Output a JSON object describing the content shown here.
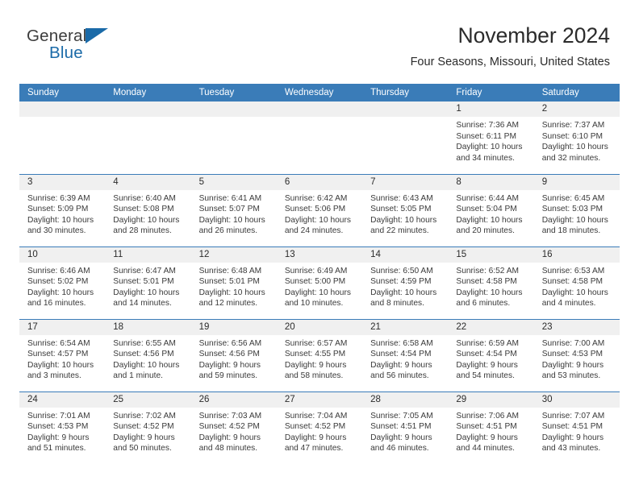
{
  "brand": {
    "word1": "General",
    "word2": "Blue",
    "accent_color": "#1a6aa8",
    "triangle_icon": "brand-triangle-icon"
  },
  "header": {
    "title": "November 2024",
    "subtitle": "Four Seasons, Missouri, United States"
  },
  "calendar": {
    "header_bg": "#3a7cb8",
    "header_text_color": "#ffffff",
    "day_band_bg": "#f0f0f0",
    "weekday_labels": [
      "Sunday",
      "Monday",
      "Tuesday",
      "Wednesday",
      "Thursday",
      "Friday",
      "Saturday"
    ],
    "weeks": [
      [
        {
          "day": "",
          "lines": []
        },
        {
          "day": "",
          "lines": []
        },
        {
          "day": "",
          "lines": []
        },
        {
          "day": "",
          "lines": []
        },
        {
          "day": "",
          "lines": []
        },
        {
          "day": "1",
          "lines": [
            "Sunrise: 7:36 AM",
            "Sunset: 6:11 PM",
            "Daylight: 10 hours",
            "and 34 minutes."
          ]
        },
        {
          "day": "2",
          "lines": [
            "Sunrise: 7:37 AM",
            "Sunset: 6:10 PM",
            "Daylight: 10 hours",
            "and 32 minutes."
          ]
        }
      ],
      [
        {
          "day": "3",
          "lines": [
            "Sunrise: 6:39 AM",
            "Sunset: 5:09 PM",
            "Daylight: 10 hours",
            "and 30 minutes."
          ]
        },
        {
          "day": "4",
          "lines": [
            "Sunrise: 6:40 AM",
            "Sunset: 5:08 PM",
            "Daylight: 10 hours",
            "and 28 minutes."
          ]
        },
        {
          "day": "5",
          "lines": [
            "Sunrise: 6:41 AM",
            "Sunset: 5:07 PM",
            "Daylight: 10 hours",
            "and 26 minutes."
          ]
        },
        {
          "day": "6",
          "lines": [
            "Sunrise: 6:42 AM",
            "Sunset: 5:06 PM",
            "Daylight: 10 hours",
            "and 24 minutes."
          ]
        },
        {
          "day": "7",
          "lines": [
            "Sunrise: 6:43 AM",
            "Sunset: 5:05 PM",
            "Daylight: 10 hours",
            "and 22 minutes."
          ]
        },
        {
          "day": "8",
          "lines": [
            "Sunrise: 6:44 AM",
            "Sunset: 5:04 PM",
            "Daylight: 10 hours",
            "and 20 minutes."
          ]
        },
        {
          "day": "9",
          "lines": [
            "Sunrise: 6:45 AM",
            "Sunset: 5:03 PM",
            "Daylight: 10 hours",
            "and 18 minutes."
          ]
        }
      ],
      [
        {
          "day": "10",
          "lines": [
            "Sunrise: 6:46 AM",
            "Sunset: 5:02 PM",
            "Daylight: 10 hours",
            "and 16 minutes."
          ]
        },
        {
          "day": "11",
          "lines": [
            "Sunrise: 6:47 AM",
            "Sunset: 5:01 PM",
            "Daylight: 10 hours",
            "and 14 minutes."
          ]
        },
        {
          "day": "12",
          "lines": [
            "Sunrise: 6:48 AM",
            "Sunset: 5:01 PM",
            "Daylight: 10 hours",
            "and 12 minutes."
          ]
        },
        {
          "day": "13",
          "lines": [
            "Sunrise: 6:49 AM",
            "Sunset: 5:00 PM",
            "Daylight: 10 hours",
            "and 10 minutes."
          ]
        },
        {
          "day": "14",
          "lines": [
            "Sunrise: 6:50 AM",
            "Sunset: 4:59 PM",
            "Daylight: 10 hours",
            "and 8 minutes."
          ]
        },
        {
          "day": "15",
          "lines": [
            "Sunrise: 6:52 AM",
            "Sunset: 4:58 PM",
            "Daylight: 10 hours",
            "and 6 minutes."
          ]
        },
        {
          "day": "16",
          "lines": [
            "Sunrise: 6:53 AM",
            "Sunset: 4:58 PM",
            "Daylight: 10 hours",
            "and 4 minutes."
          ]
        }
      ],
      [
        {
          "day": "17",
          "lines": [
            "Sunrise: 6:54 AM",
            "Sunset: 4:57 PM",
            "Daylight: 10 hours",
            "and 3 minutes."
          ]
        },
        {
          "day": "18",
          "lines": [
            "Sunrise: 6:55 AM",
            "Sunset: 4:56 PM",
            "Daylight: 10 hours",
            "and 1 minute."
          ]
        },
        {
          "day": "19",
          "lines": [
            "Sunrise: 6:56 AM",
            "Sunset: 4:56 PM",
            "Daylight: 9 hours",
            "and 59 minutes."
          ]
        },
        {
          "day": "20",
          "lines": [
            "Sunrise: 6:57 AM",
            "Sunset: 4:55 PM",
            "Daylight: 9 hours",
            "and 58 minutes."
          ]
        },
        {
          "day": "21",
          "lines": [
            "Sunrise: 6:58 AM",
            "Sunset: 4:54 PM",
            "Daylight: 9 hours",
            "and 56 minutes."
          ]
        },
        {
          "day": "22",
          "lines": [
            "Sunrise: 6:59 AM",
            "Sunset: 4:54 PM",
            "Daylight: 9 hours",
            "and 54 minutes."
          ]
        },
        {
          "day": "23",
          "lines": [
            "Sunrise: 7:00 AM",
            "Sunset: 4:53 PM",
            "Daylight: 9 hours",
            "and 53 minutes."
          ]
        }
      ],
      [
        {
          "day": "24",
          "lines": [
            "Sunrise: 7:01 AM",
            "Sunset: 4:53 PM",
            "Daylight: 9 hours",
            "and 51 minutes."
          ]
        },
        {
          "day": "25",
          "lines": [
            "Sunrise: 7:02 AM",
            "Sunset: 4:52 PM",
            "Daylight: 9 hours",
            "and 50 minutes."
          ]
        },
        {
          "day": "26",
          "lines": [
            "Sunrise: 7:03 AM",
            "Sunset: 4:52 PM",
            "Daylight: 9 hours",
            "and 48 minutes."
          ]
        },
        {
          "day": "27",
          "lines": [
            "Sunrise: 7:04 AM",
            "Sunset: 4:52 PM",
            "Daylight: 9 hours",
            "and 47 minutes."
          ]
        },
        {
          "day": "28",
          "lines": [
            "Sunrise: 7:05 AM",
            "Sunset: 4:51 PM",
            "Daylight: 9 hours",
            "and 46 minutes."
          ]
        },
        {
          "day": "29",
          "lines": [
            "Sunrise: 7:06 AM",
            "Sunset: 4:51 PM",
            "Daylight: 9 hours",
            "and 44 minutes."
          ]
        },
        {
          "day": "30",
          "lines": [
            "Sunrise: 7:07 AM",
            "Sunset: 4:51 PM",
            "Daylight: 9 hours",
            "and 43 minutes."
          ]
        }
      ]
    ]
  }
}
